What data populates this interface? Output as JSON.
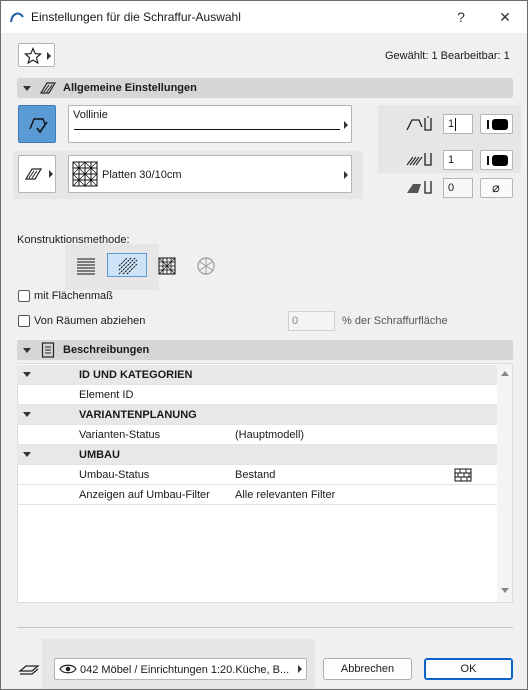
{
  "window": {
    "title": "Einstellungen für die Schraffur-Auswahl",
    "help": "?",
    "close": "✕"
  },
  "selection_info": "Gewählt: 1 Bearbeitbar: 1",
  "general": {
    "header": "Allgemeine Einstellungen",
    "line_type": "Vollinie",
    "fill_type": "Platten 30/10cm",
    "pen_contour": "1",
    "pen_fill": "1",
    "pen_background": "0",
    "construction_label": "Konstruktionsmethode:",
    "area_label": "mit Flächenmaß",
    "subtract_label": "Von Räumen abziehen",
    "subtract_value": "0",
    "subtract_suffix": "% der Schraffurfläche"
  },
  "descriptions": {
    "header": "Beschreibungen",
    "groups": [
      {
        "title": "ID UND KATEGORIEN",
        "rows": [
          {
            "name": "Element ID",
            "value": ""
          }
        ]
      },
      {
        "title": "VARIANTENPLANUNG",
        "rows": [
          {
            "name": "Varianten-Status",
            "value": "(Hauptmodell)"
          }
        ]
      },
      {
        "title": "UMBAU",
        "rows": [
          {
            "name": "Umbau-Status",
            "value": "Bestand"
          },
          {
            "name": "Anzeigen auf Umbau-Filter",
            "value": "Alle relevanten Filter"
          }
        ]
      }
    ]
  },
  "footer": {
    "layer": "042 Möbel / Einrichtungen 1:20.Küche, B...",
    "cancel": "Abbrechen",
    "ok": "OK"
  }
}
